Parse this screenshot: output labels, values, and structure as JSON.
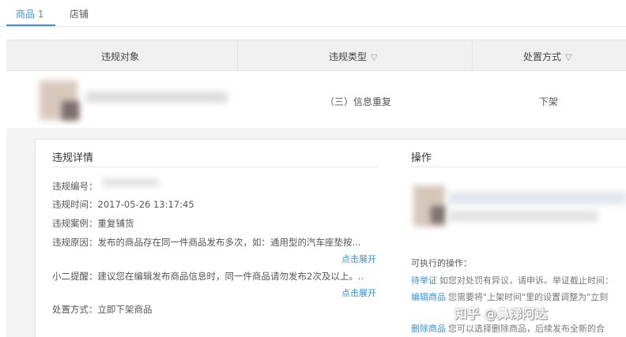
{
  "tabs": [
    {
      "label": "商品 1",
      "active": true
    },
    {
      "label": "店铺",
      "active": false
    }
  ],
  "table": {
    "headers": [
      {
        "label": "违规对象",
        "filter": false
      },
      {
        "label": "违规类型",
        "filter": true
      },
      {
        "label": "处置方式",
        "filter": true
      }
    ],
    "row": {
      "type": "（三）信息重复",
      "action": "下架"
    }
  },
  "details": {
    "title": "违规详情",
    "lines": {
      "id_label": "违规编号：",
      "time": "违规时间：2017-05-26 13:17:45",
      "case": "违规案例：重复铺货",
      "reason": "违规原因：发布的商品存在同一件商品发布多次，如：通用型的汽车座垫按...",
      "tip": "小二提醒：建议您在编辑发布商品信息时，同一件商品请勿发布2次及以上。..",
      "method": "处置方式：立即下架商品"
    },
    "expand_label": "点击展开"
  },
  "operations": {
    "title": "操作",
    "executable_label": "可执行的操作：",
    "items": [
      {
        "link": "待举证",
        "text": "如您对处罚有异议，请申诉。举证截止时间："
      },
      {
        "link": "编辑商品",
        "text": "您需要将\"上架时间\"里的设置调整为\"立刻"
      },
      {
        "link": "删除商品",
        "text": "您可以选择删除商品，后续发布全新的合"
      }
    ]
  },
  "watermark": "知乎 @鼻涕阿达",
  "colors": {
    "accent": "#3c8fd7",
    "header_bg": "#f0f0f0",
    "panel_bg": "#f4f4f4"
  }
}
